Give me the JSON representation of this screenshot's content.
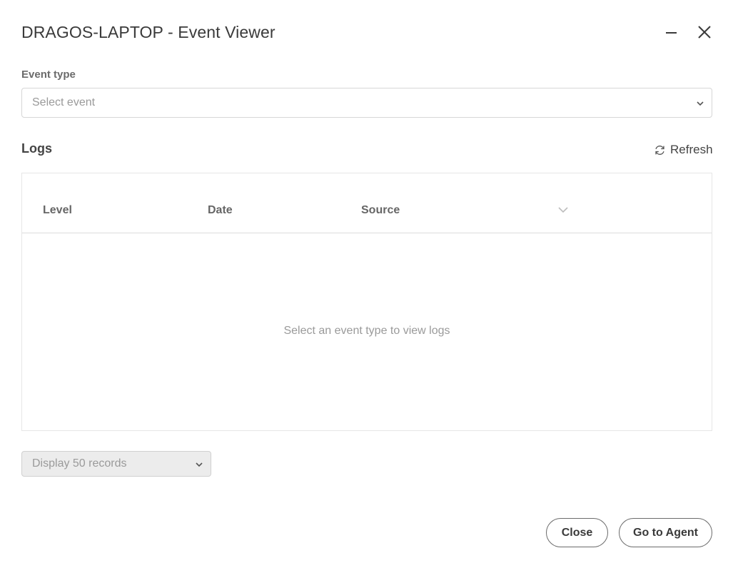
{
  "window": {
    "title": "DRAGOS-LAPTOP - Event Viewer",
    "minimize_icon": "minimize-icon",
    "close_icon": "close-icon"
  },
  "event_type": {
    "label": "Event type",
    "placeholder": "Select event"
  },
  "logs": {
    "title": "Logs",
    "refresh_label": "Refresh",
    "columns": [
      "Level",
      "Date",
      "Source"
    ],
    "empty_message": "Select an event type to view logs"
  },
  "records": {
    "selected": "Display 50 records"
  },
  "footer": {
    "close_label": "Close",
    "agent_label": "Go to Agent"
  },
  "colors": {
    "text": "#3a3a3a",
    "muted": "#9a9a9a",
    "border": "#d6d6d6"
  }
}
